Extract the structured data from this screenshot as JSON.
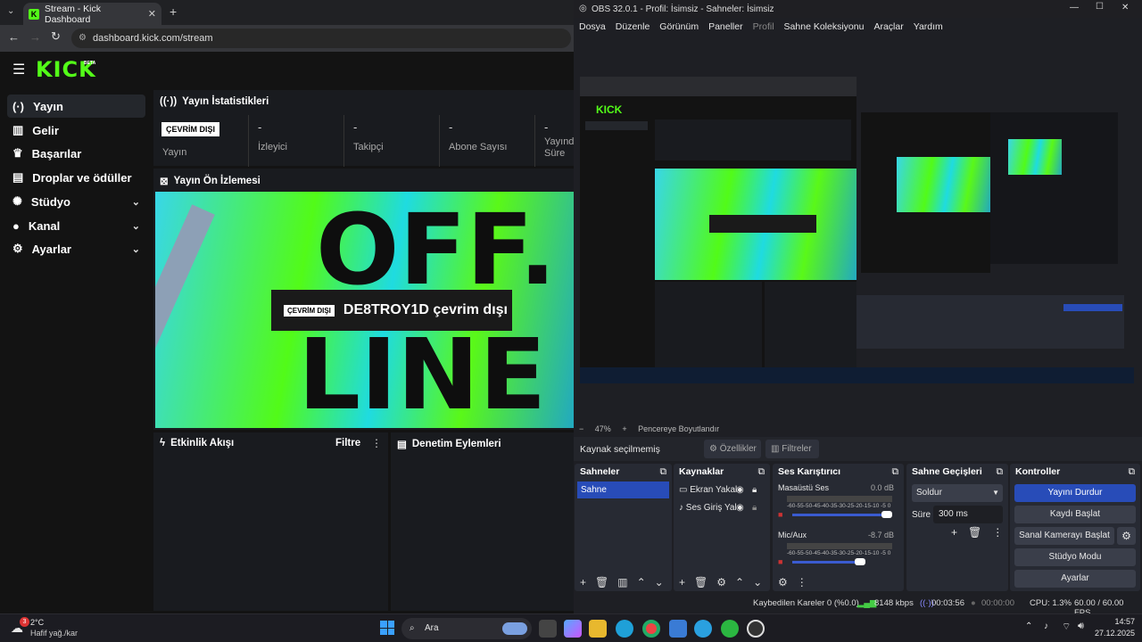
{
  "browser": {
    "tab_title": "Stream - Kick Dashboard",
    "url": "dashboard.kick.com/stream"
  },
  "kick": {
    "logo": "KICK",
    "logo_badge": "BETA",
    "sidebar": [
      {
        "label": "Yayın",
        "icon": "broadcast-icon",
        "active": true
      },
      {
        "label": "Gelir",
        "icon": "chart-icon"
      },
      {
        "label": "Başarılar",
        "icon": "trophy-icon"
      },
      {
        "label": "Droplar ve ödüller",
        "icon": "gift-icon"
      },
      {
        "label": "Stüdyo",
        "icon": "studio-icon",
        "expandable": true
      },
      {
        "label": "Kanal",
        "icon": "user-icon",
        "expandable": true
      },
      {
        "label": "Ayarlar",
        "icon": "gear-icon",
        "expandable": true
      }
    ],
    "stats": {
      "title": "Yayın İstatistikleri",
      "badge": "ÇEVRİM DIŞI",
      "cols": [
        {
          "value": "",
          "label": "Yayın"
        },
        {
          "value": "-",
          "label": "İzleyici"
        },
        {
          "value": "-",
          "label": "Takipçi"
        },
        {
          "value": "-",
          "label": "Abone Sayısı"
        },
        {
          "value": "-",
          "label": "Yayında Süre"
        }
      ]
    },
    "preview": {
      "title": "Yayın Ön İzlemesi",
      "badge": "ÇEVRİM DIŞI",
      "text": "DE8TROY1D çevrim dışı",
      "art_line1": "OFF.",
      "art_line2": "LINE"
    },
    "activity": {
      "title": "Etkinlik Akışı",
      "filter": "Filtre"
    },
    "moderation": {
      "title": "Denetim Eylemleri"
    }
  },
  "obs": {
    "title": "OBS 32.0.1 - Profil: İsimsiz - Sahneler: İsimsiz",
    "menu": [
      "Dosya",
      "Düzenle",
      "Görünüm",
      "Paneller",
      "Profil",
      "Sahne Koleksiyonu",
      "Araçlar",
      "Yardım"
    ],
    "zoom": "47%",
    "fit_label": "Pencereye Boyutlandır",
    "no_source": "Kaynak seçilmemiş",
    "properties": "Özellikler",
    "filters": "Filtreler",
    "scenes": {
      "title": "Sahneler",
      "items": [
        "Sahne"
      ]
    },
    "sources": {
      "title": "Kaynaklar",
      "items": [
        "Ekran Yakal",
        "Ses Giriş Yal"
      ]
    },
    "mixer": {
      "title": "Ses Karıştırıcı",
      "channels": [
        {
          "name": "Masaüstü Ses",
          "db": "0.0 dB",
          "level": 0.96
        },
        {
          "name": "Mic/Aux",
          "db": "-8.7 dB",
          "level": 0.68
        }
      ],
      "scale": "-60-55-50-45-40-35-30-25-20-15-10 -5 0"
    },
    "transitions": {
      "title": "Sahne Geçişleri",
      "type": "Soldur",
      "duration_label": "Süre",
      "duration": "300 ms"
    },
    "controls": {
      "title": "Kontroller",
      "buttons": [
        "Yayını Durdur",
        "Kaydı Başlat",
        "Sanal Kamerayı Başlat",
        "Stüdyo Modu",
        "Ayarlar"
      ]
    },
    "status": {
      "dropped": "Kaybedilen Kareler 0 (%0.0)",
      "bitrate": "8148 kbps",
      "stream_time": "00:03:56",
      "rec_time": "00:00:00",
      "cpu": "CPU: 1.3%",
      "fps": "60.00 / 60.00 FPS"
    }
  },
  "taskbar": {
    "weather_temp": "2°C",
    "weather_text": "Hafif yağ./kar",
    "weather_badge": "3",
    "search": "Ara",
    "time": "14:57",
    "date": "27.12.2025"
  }
}
